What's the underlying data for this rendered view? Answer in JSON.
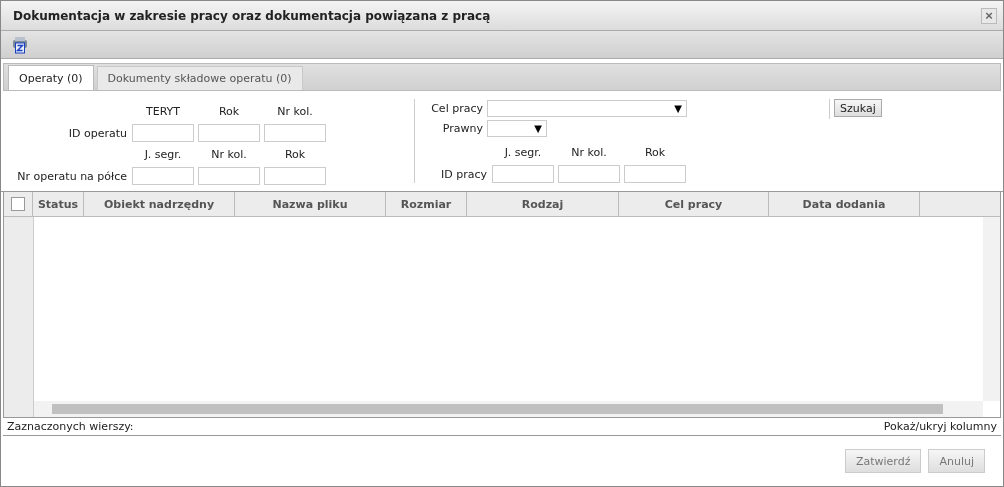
{
  "window": {
    "title": "Dokumentacja w zakresie pracy oraz dokumentacja powiązana z pracą",
    "close": "×"
  },
  "tabs": [
    {
      "label": "Operaty (0)",
      "selected": true
    },
    {
      "label": "Dokumenty składowe operatu (0)",
      "selected": false
    }
  ],
  "filters_left": [
    {
      "label": "ID operatu",
      "headers": [
        "TERYT",
        "Rok",
        "Nr kol."
      ]
    },
    {
      "label": "Nr operatu na półce",
      "headers": [
        "J. segr.",
        "Nr kol.",
        "Rok"
      ]
    }
  ],
  "filters_right": {
    "cel_pracy": {
      "label": "Cel pracy",
      "arrow": "▼"
    },
    "prawny": {
      "label": "Prawny",
      "arrow": "▼"
    },
    "id_pracy": {
      "label": "ID pracy",
      "headers": [
        "J. segr.",
        "Nr kol.",
        "Rok"
      ]
    }
  },
  "search_button": "Szukaj",
  "table": {
    "select_all": {
      "checked": false
    },
    "columns": [
      "Status",
      "Obiekt nadrzędny",
      "Nazwa pliku",
      "Rozmiar",
      "Rodzaj",
      "Cel pracy",
      "Data dodania"
    ]
  },
  "status_bar": {
    "selected": "Zaznaczonych wierszy:",
    "toggle_columns": "Pokaż/ukryj kolumny"
  },
  "buttons": [
    {
      "label": "Zatwierdź",
      "disabled": true
    },
    {
      "label": "Anuluj",
      "disabled": true
    }
  ]
}
